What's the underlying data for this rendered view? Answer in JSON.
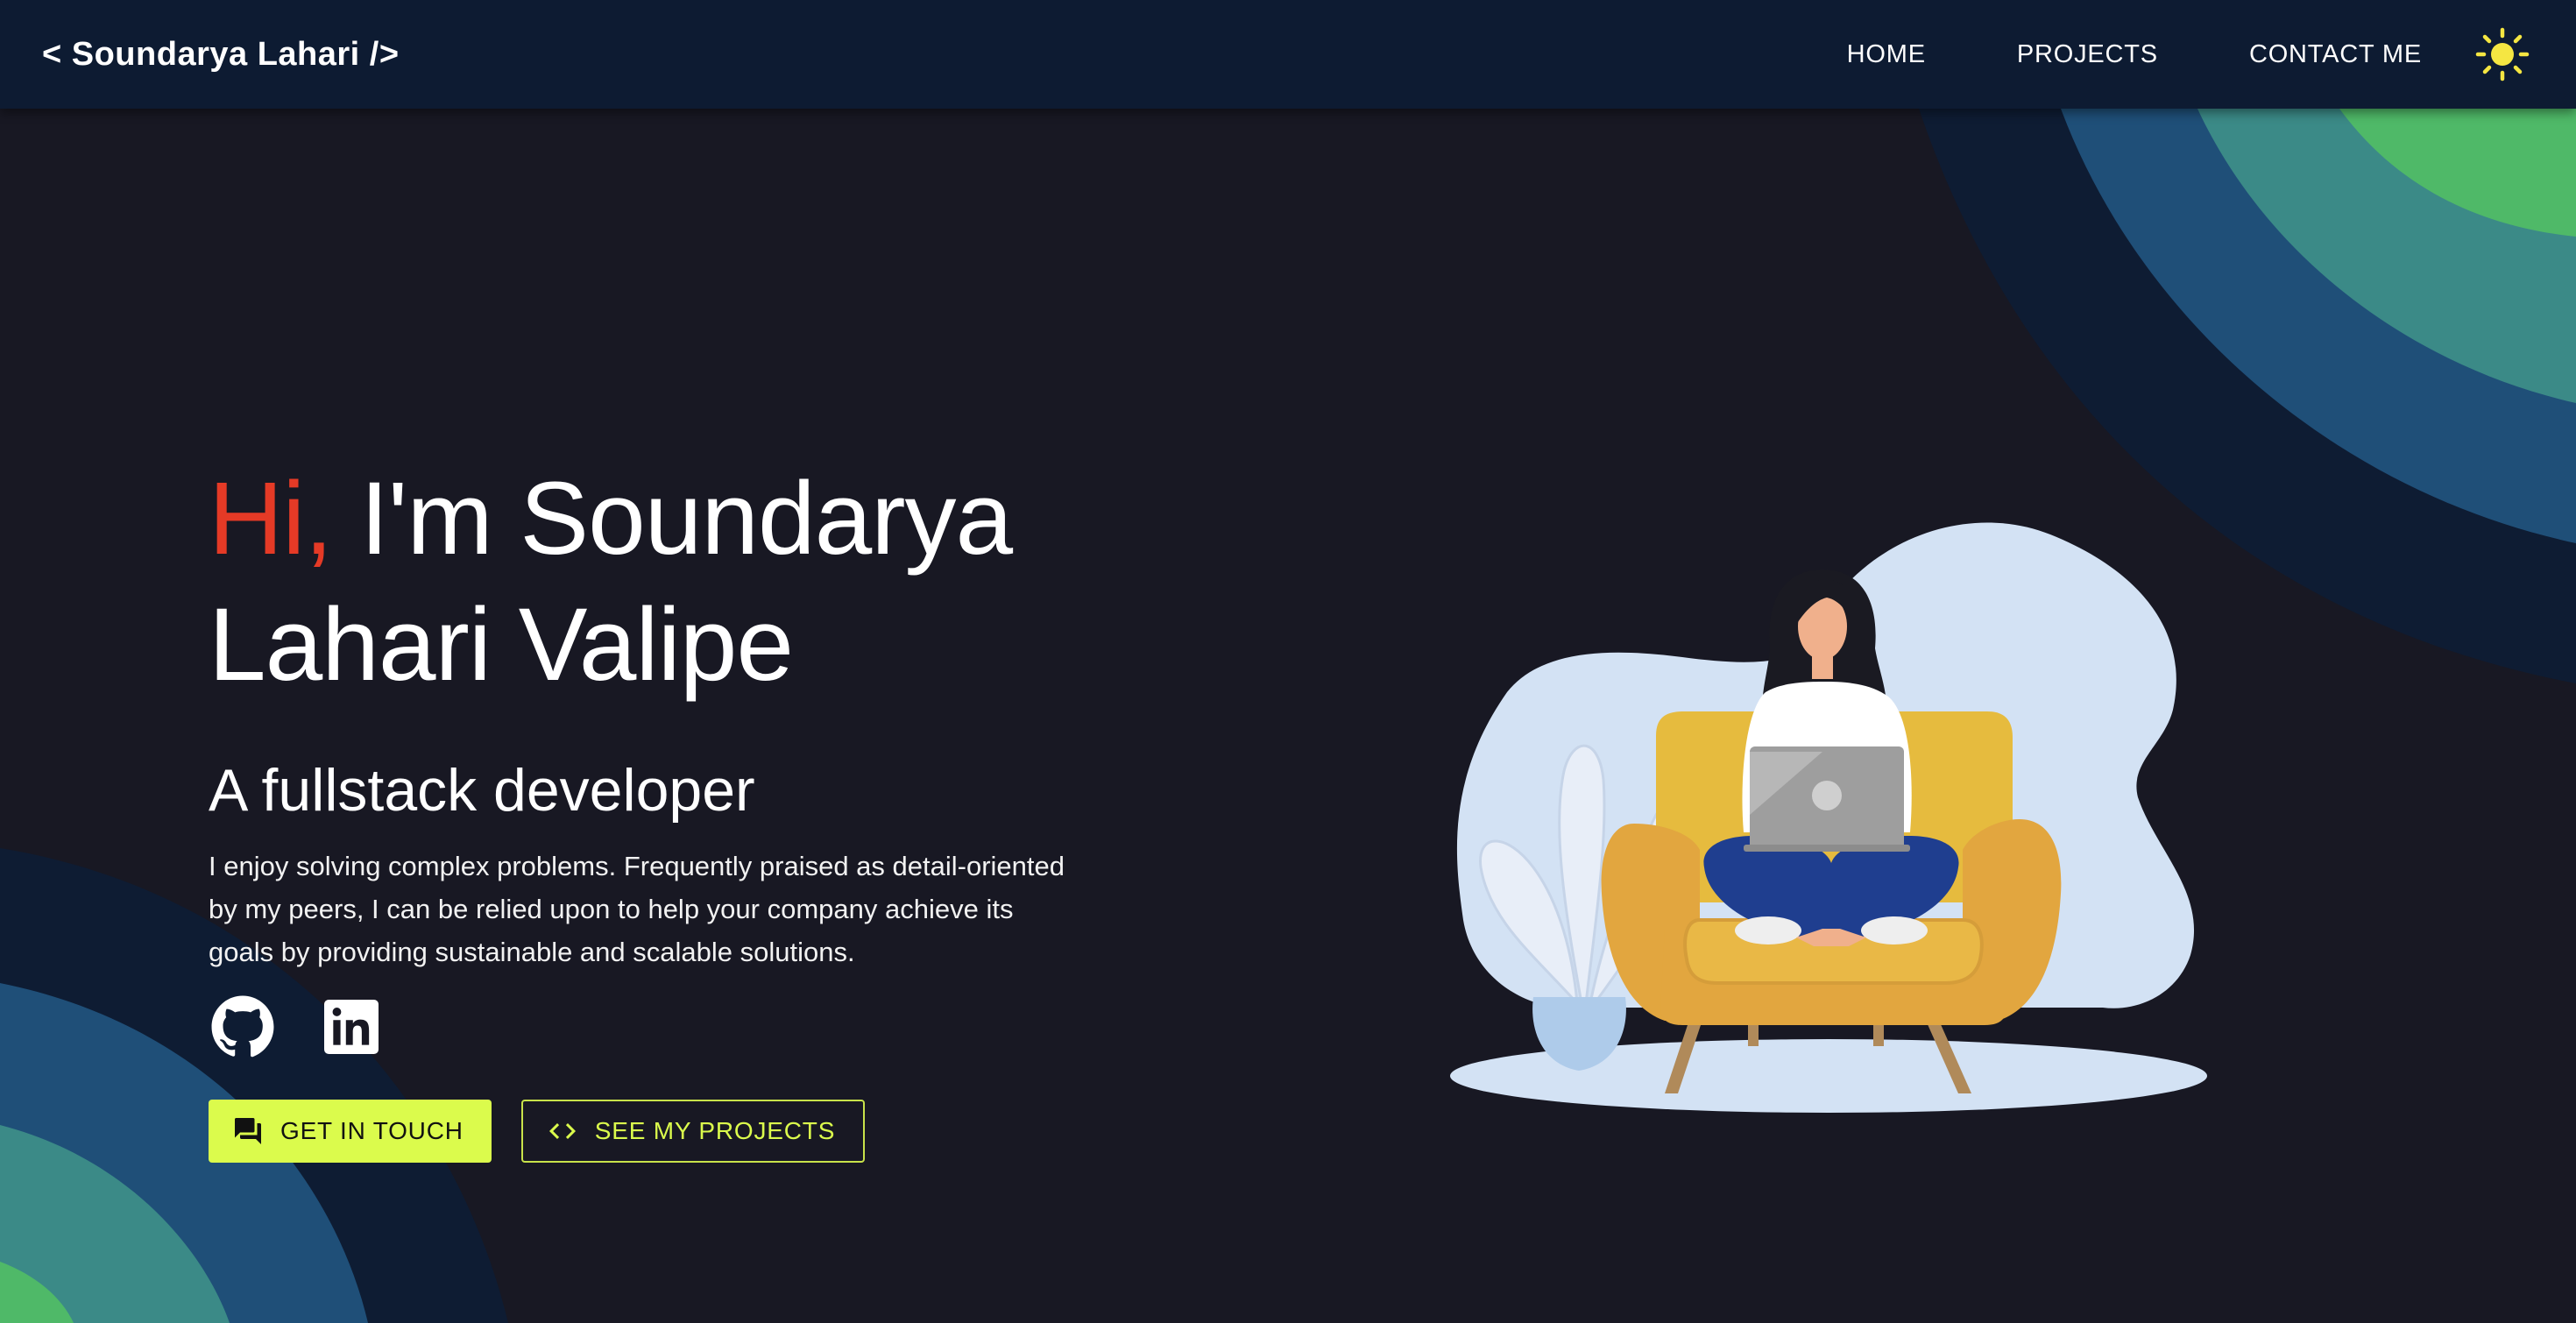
{
  "brand": "< Soundarya Lahari />",
  "nav": {
    "items": [
      "HOME",
      "PROJECTS",
      "CONTACT ME"
    ],
    "theme_icon": "sun-icon"
  },
  "hero": {
    "greeting": "Hi,",
    "name": " I'm Soundarya Lahari Valipe",
    "subtitle": "A fullstack developer",
    "bio": "I enjoy solving complex problems. Frequently praised as detail-oriented by my peers, I can be relied upon to help your company achieve its goals by providing sustainable and scalable solutions.",
    "socials": [
      "github-icon",
      "linkedin-icon"
    ],
    "buttons": {
      "primary": "GET IN TOUCH",
      "primary_icon": "chat-icon",
      "secondary": "SEE MY PROJECTS",
      "secondary_icon": "code-icon"
    }
  },
  "colors": {
    "background": "#181823",
    "navbar": "#0d1b32",
    "accent": "#dbfb4c",
    "greeting": "#e53a26",
    "sun": "#f5e642",
    "wave_navy": "#0e1c33",
    "wave_blue": "#1f4f78",
    "wave_teal": "#3b8a87",
    "wave_green": "#4fb968"
  }
}
